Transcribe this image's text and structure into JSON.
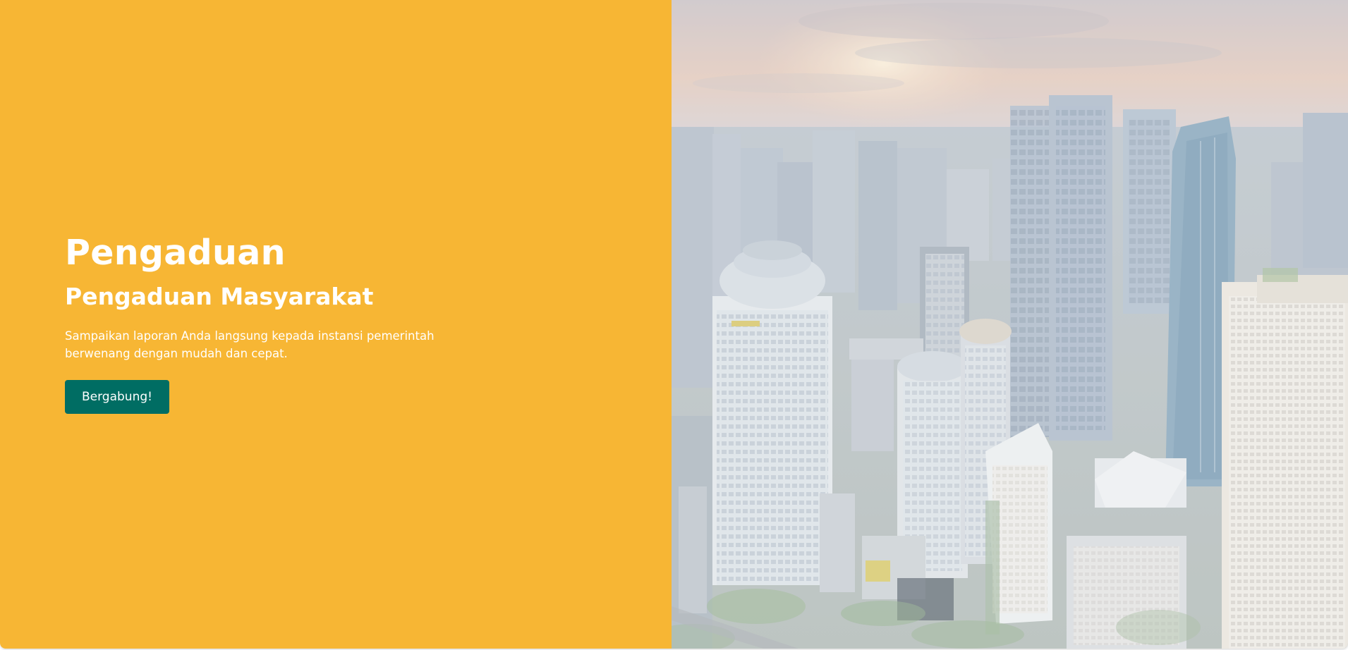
{
  "hero": {
    "title": "Pengaduan",
    "subtitle": "Pengaduan Masyarakat",
    "description": "Sampaikan laporan Anda langsung kepada instansi pemerintah berwenang dengan mudah dan cepat.",
    "cta_label": "Bergabung!",
    "image_alt": "City skyline"
  },
  "colors": {
    "accent_yellow": "#F7B634",
    "button_green": "#006D63",
    "text_white": "#FFFFFF"
  }
}
